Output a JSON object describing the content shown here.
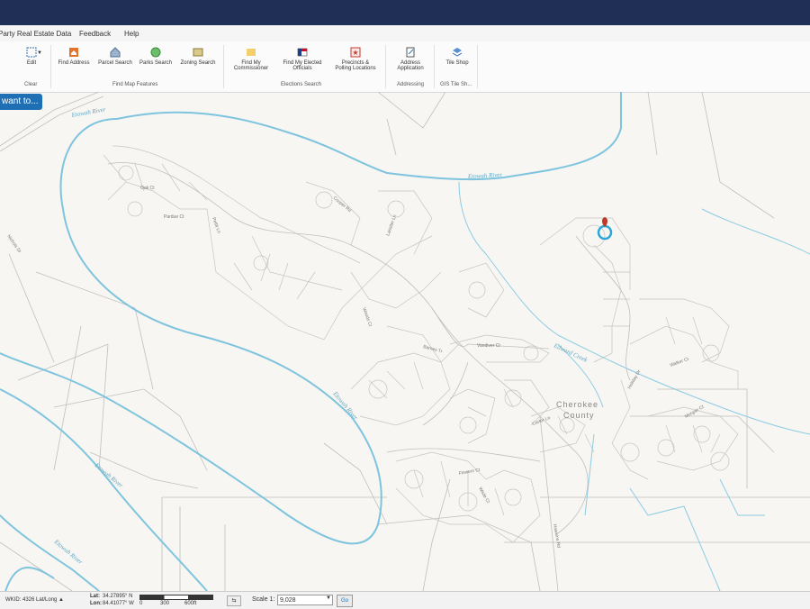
{
  "menu": {
    "item1": "Party Real Estate Data",
    "item2": "Feedback",
    "item3": "Help"
  },
  "ribbon": {
    "edit": "Edit",
    "clear": "Clear",
    "find_address": "Find Address",
    "parcel_search": "Parcel Search",
    "parks_search": "Parks Search",
    "zoning_search": "Zoning Search",
    "find_commissioner": [
      "Find My",
      "Commissioner"
    ],
    "find_officials": [
      "Find My Elected",
      "Officials"
    ],
    "precincts": [
      "Precincts &",
      "Polling Locations"
    ],
    "address_app": [
      "Address",
      "Application"
    ],
    "tile_shop": "Tile Shop",
    "group_find": "Find Map Features",
    "group_elections": "Elections Search",
    "group_addressing": "Addressing",
    "group_tile": "GIS Tile Sh..."
  },
  "iwant_label": "want to...",
  "map_labels": {
    "rivers": [
      "Etowah River",
      "Etowah River",
      "Etowah River",
      "Etowah River",
      "Etowah River",
      "Etowah River"
    ],
    "creek": "Edward Creek",
    "county": [
      "Cherokee",
      "County"
    ],
    "streets": [
      "Oak Ct",
      "Pardue Ct",
      "Pettit Ln",
      "Vandiver Ct",
      "Barnes Tr",
      "Carter Ln",
      "Walker Ct",
      "Holiday Dr",
      "Lassiter Ln",
      "Woods Ct",
      "Flowers Ct",
      "Wade Ct",
      "Hawkins Rd",
      "Nichols Dr",
      "Morgan Ct",
      "Cooper Rd"
    ]
  },
  "status": {
    "wkid": "WKID: 4326 Lat/Long ▲",
    "lat_label": "Lat:",
    "lat": "34.27895° N",
    "lon_label": "Lon:",
    "lon": "84.41077° W",
    "scale_ticks": [
      "0",
      "300",
      "600ft"
    ],
    "scale_label": "Scale 1:",
    "scale_value": "9,028",
    "go": "Go"
  },
  "colors": {
    "titlebar": "#1f2f55",
    "river": "#7fc4de",
    "button": "#1f6fb5",
    "marker": "#c0392b"
  }
}
